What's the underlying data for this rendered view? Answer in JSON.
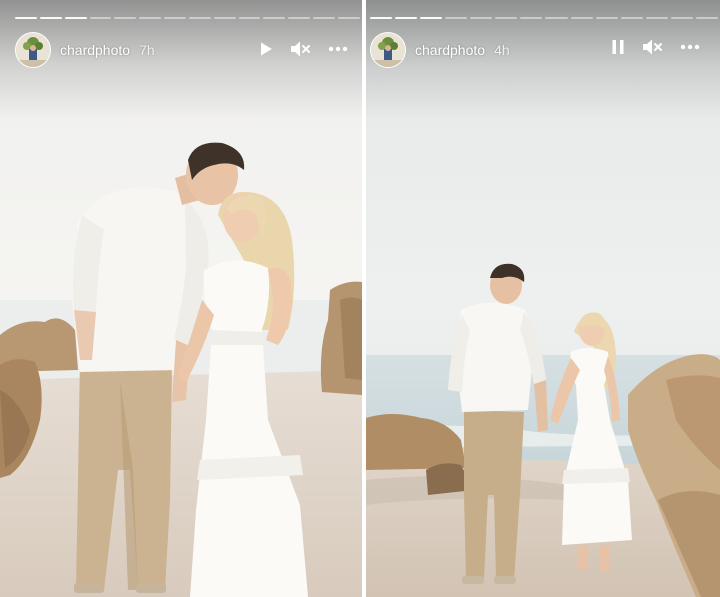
{
  "stories": [
    {
      "username": "chardphoto",
      "time": "7h",
      "playback_icon": "play-icon",
      "sound_icon": "muted-speaker-icon",
      "menu_icon": "more-horizontal-icon",
      "progress_segments": 14,
      "progress_filled": 3
    },
    {
      "username": "chardphoto",
      "time": "4h",
      "playback_icon": "pause-icon",
      "sound_icon": "muted-speaker-icon",
      "menu_icon": "more-horizontal-icon",
      "progress_segments": 14,
      "progress_filled": 3
    }
  ],
  "colors": {
    "sky": "#f4f3ef",
    "sand": "#e2d8cd",
    "rock": "#b8976f",
    "sea": "#d9e2e6",
    "shirt": "#f8f7f3",
    "pants": "#c9b08d",
    "hair_man": "#3e3127",
    "hair_woman": "#e7d3a9",
    "dress": "#fbfaf6"
  }
}
